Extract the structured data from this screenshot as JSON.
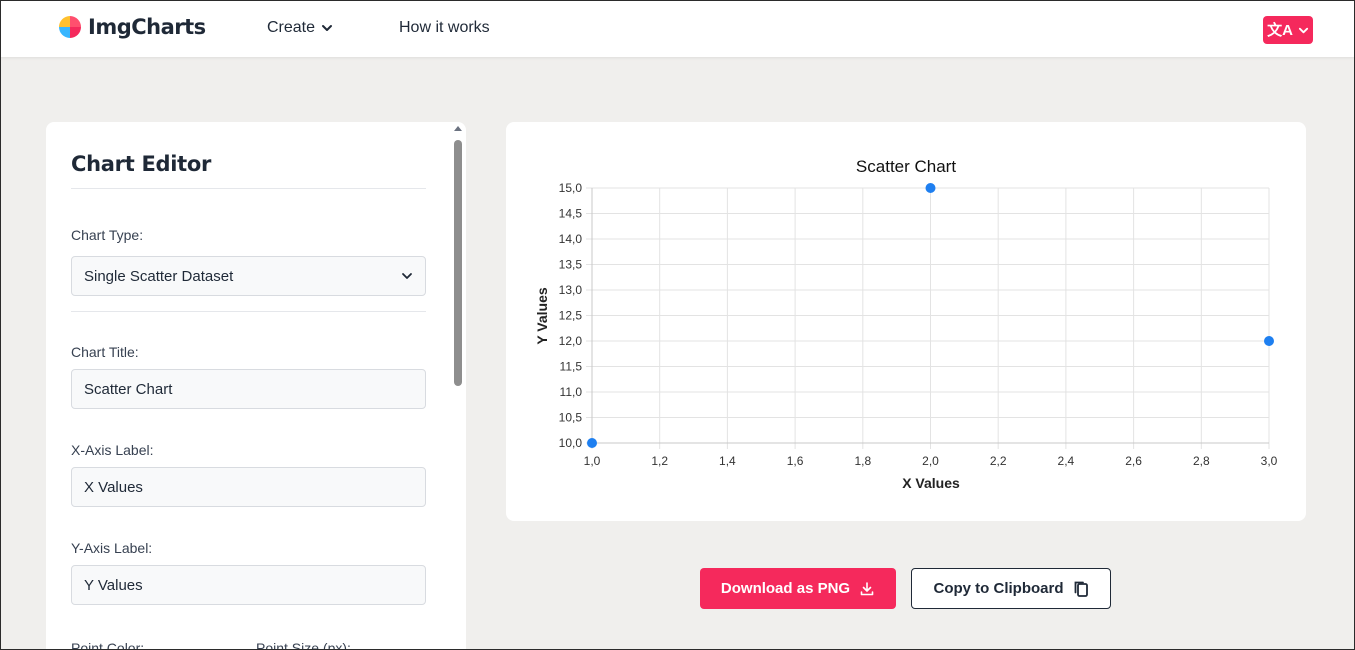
{
  "header": {
    "brand": "ImgCharts",
    "nav": {
      "create": "Create",
      "how_it_works": "How it works"
    },
    "lang_glyph": "文A"
  },
  "editor": {
    "title": "Chart Editor",
    "chart_type_label": "Chart Type:",
    "chart_type_value": "Single Scatter Dataset",
    "chart_title_label": "Chart Title:",
    "chart_title_value": "Scatter Chart",
    "x_label_label": "X-Axis Label:",
    "x_label_value": "X Values",
    "y_label_label": "Y-Axis Label:",
    "y_label_value": "Y Values",
    "point_color_label": "Point Color:",
    "point_size_label": "Point Size (px):"
  },
  "actions": {
    "download": "Download as PNG",
    "copy": "Copy to Clipboard"
  },
  "colors": {
    "accent": "#f5295c",
    "point": "#1e7ff0"
  },
  "chart_data": {
    "type": "scatter",
    "title": "Scatter Chart",
    "xlabel": "X Values",
    "ylabel": "Y Values",
    "xlim": [
      1.0,
      3.0
    ],
    "ylim": [
      10.0,
      15.0
    ],
    "x_ticks": [
      "1,0",
      "1,2",
      "1,4",
      "1,6",
      "1,8",
      "2,0",
      "2,2",
      "2,4",
      "2,6",
      "2,8",
      "3,0"
    ],
    "y_ticks": [
      "10,0",
      "10,5",
      "11,0",
      "11,5",
      "12,0",
      "12,5",
      "13,0",
      "13,5",
      "14,0",
      "14,5",
      "15,0"
    ],
    "grid": true,
    "series": [
      {
        "points": [
          {
            "x": 1,
            "y": 10
          },
          {
            "x": 2,
            "y": 15
          },
          {
            "x": 3,
            "y": 12
          }
        ]
      }
    ]
  }
}
